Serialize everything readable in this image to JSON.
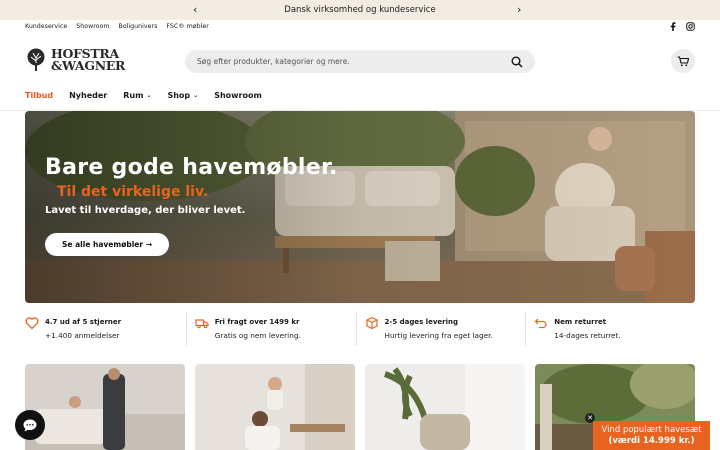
{
  "announcement": {
    "text": "Dansk virksomhed og kundeservice"
  },
  "top_links": [
    "Kundeservice",
    "Showroom",
    "Boligunivers",
    "FSC® møbler"
  ],
  "logo": {
    "line1": "HOFSTRA",
    "line2": "&WAGNER"
  },
  "search": {
    "placeholder": "Søg efter produkter, kategorier og mere."
  },
  "nav": [
    {
      "label": "Tilbud"
    },
    {
      "label": "Nyheder"
    },
    {
      "label": "Rum"
    },
    {
      "label": "Shop"
    },
    {
      "label": "Showroom"
    }
  ],
  "hero": {
    "headline": "Bare gode havemøbler.",
    "subheadline": "Til det virkelige liv.",
    "tagline": "Lavet til hverdage, der bliver levet.",
    "cta": "Se alle havemøbler →"
  },
  "usps": [
    {
      "icon": "heart-icon",
      "title": "4.7 ud af 5 stjerner",
      "desc": "+1.400 anmeldelser"
    },
    {
      "icon": "truck-icon",
      "title": "Fri fragt over 1499 kr",
      "desc": "Gratis og nem levering."
    },
    {
      "icon": "box-icon",
      "title": "2-5 dages levering",
      "desc": "Hurtig levering fra eget lager."
    },
    {
      "icon": "return-icon",
      "title": "Nem returret",
      "desc": "14-dages returret."
    }
  ],
  "promo": {
    "line1": "Vind populært havesæt",
    "line2": "(værdi 14.999 kr.)"
  },
  "colors": {
    "accent": "#e8631f",
    "announcement_bg": "#f3ece3"
  }
}
